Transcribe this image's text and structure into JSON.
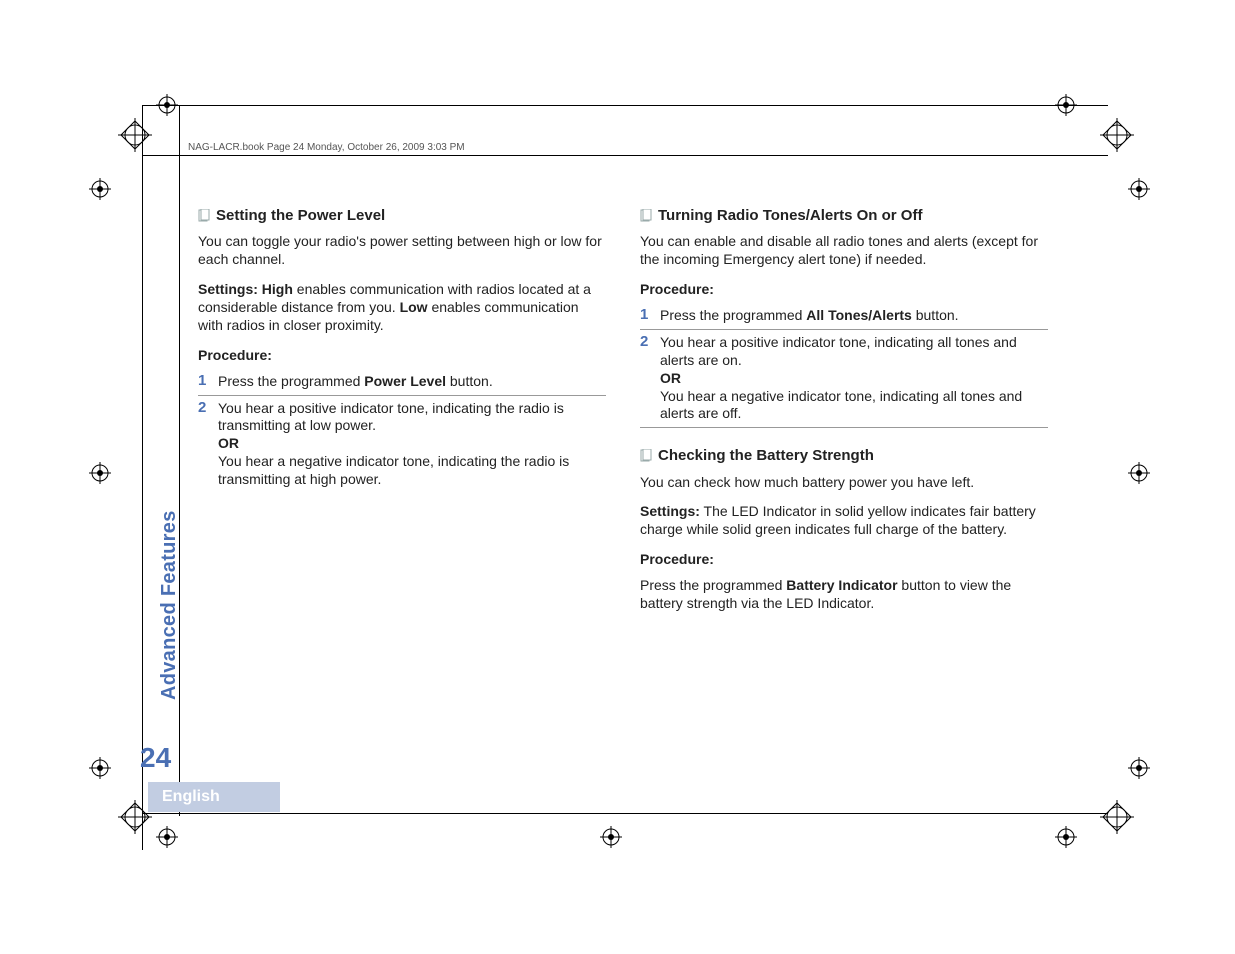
{
  "header": "NAG-LACR.book  Page 24  Monday, October 26, 2009  3:03 PM",
  "sidebar_label": "Advanced Features",
  "page_number": "24",
  "language": "English",
  "left": {
    "h": "Setting the Power Level",
    "intro": "You can toggle your radio's power setting between high or low for each channel.",
    "settings_pre": "Settings:  High",
    "settings_mid": " enables communication with radios located at a considerable distance from you. ",
    "settings_low": "Low",
    "settings_post": " enables communication with radios in closer proximity.",
    "proc": "Procedure:",
    "s1_pre": "Press the programmed ",
    "s1_b": "Power Level",
    "s1_post": " button.",
    "s2a": "You hear a positive indicator tone, indicating the radio is transmitting at low power.",
    "or": "OR",
    "s2b": "You hear a negative indicator tone, indicating the radio is transmitting at high power."
  },
  "rightA": {
    "h": "Turning Radio Tones/Alerts On or Off",
    "intro": "You can enable and disable all radio tones and alerts (except for the incoming Emergency alert tone) if needed.",
    "proc": "Procedure:",
    "s1_pre": "Press the programmed ",
    "s1_b": "All Tones/Alerts",
    "s1_post": " button.",
    "s2a": "You hear a positive indicator tone, indicating all tones and alerts are on.",
    "or": "OR",
    "s2b": "You hear a negative indicator tone, indicating all tones and alerts are off."
  },
  "rightB": {
    "h": "Checking the Battery Strength",
    "intro": "You can check how much battery power you have left.",
    "settings_pre": "Settings:",
    "settings_post": " The LED Indicator in solid yellow indicates fair battery charge while solid green indicates full charge of the battery.",
    "proc": "Procedure:",
    "p_pre": "Press the programmed ",
    "p_b": "Battery Indicator",
    "p_post": " button to view the battery strength via the LED Indicator."
  },
  "nums": {
    "n1": "1",
    "n2": "2"
  }
}
